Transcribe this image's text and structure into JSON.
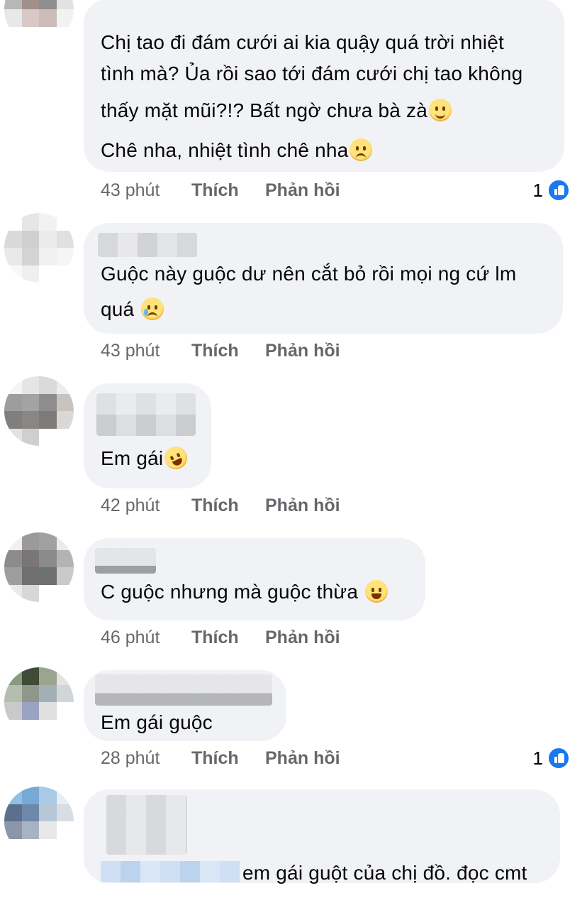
{
  "comments": [
    {
      "lines": [
        "Chị tao đi đám cưới ai kia quậy quá trời nhiệt",
        "tình mà? Ủa rồi sao tới đám cưới chị tao không",
        "thấy mặt mũi?!? Bất ngờ chưa bà zà",
        "Chê nha, nhiệt tình chê nha"
      ],
      "time": "43 phút",
      "like": "Thích",
      "reply": "Phản hồi",
      "reactions": "1"
    },
    {
      "lines": [
        "Guộc này guộc dư nên cắt bỏ rồi mọi ng cứ lm",
        "quá"
      ],
      "time": "43 phút",
      "like": "Thích",
      "reply": "Phản hồi"
    },
    {
      "lines": [
        "Em gái"
      ],
      "time": "42 phút",
      "like": "Thích",
      "reply": "Phản hồi"
    },
    {
      "lines": [
        "C guộc nhưng mà guộc thừa"
      ],
      "time": "46 phút",
      "like": "Thích",
      "reply": "Phản hồi"
    },
    {
      "lines": [
        "Em gái guộc"
      ],
      "time": "28 phút",
      "like": "Thích",
      "reply": "Phản hồi",
      "reactions": "1"
    },
    {
      "lines": [
        "em gái guột của chị đồ. đọc cmt"
      ]
    }
  ],
  "icons": {
    "emoji_upside_down": "upside-down-face-icon",
    "emoji_unamused": "unamused-face-icon",
    "emoji_crying": "crying-face-icon",
    "emoji_rofl": "rolling-laughing-icon",
    "emoji_joy": "tears-of-joy-icon",
    "like_badge": "like-thumb-icon"
  },
  "colors": {
    "bubble": "#f0f2f5",
    "meta": "#65676b",
    "like_blue": "#1877f2"
  }
}
